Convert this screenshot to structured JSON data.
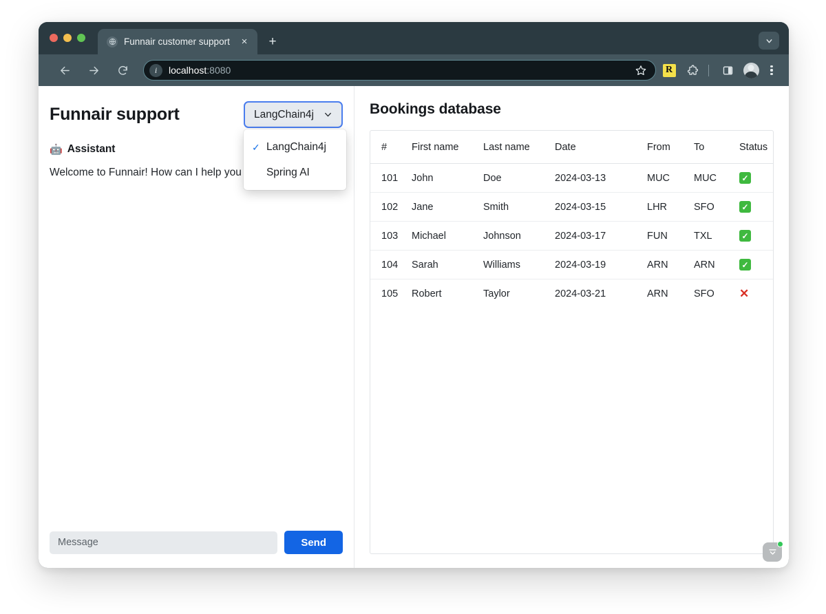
{
  "browser": {
    "tab": {
      "title": "Funnair customer support",
      "favicon_icon": "globe-icon",
      "close_icon": "×"
    },
    "new_tab_icon": "+",
    "tab_list_icon": "chevron-down-icon",
    "toolbar": {
      "back_icon": "arrow-left-icon",
      "forward_icon": "arrow-right-icon",
      "reload_icon": "reload-icon",
      "site_info_icon": "info-icon",
      "url_host": "localhost",
      "url_port": ":8080",
      "bookmark_icon": "star-icon",
      "extension_r_label": "R",
      "extensions_icon": "puzzle-piece-icon",
      "side_panel_icon": "side-panel-icon",
      "profile_icon": "avatar",
      "menu_icon": "three-dots-icon"
    }
  },
  "chat": {
    "title": "Funnair support",
    "model_select": {
      "selected": "LangChain4j",
      "chevron_icon": "chevron-down-icon",
      "open": true,
      "options": [
        {
          "label": "LangChain4j",
          "selected": true,
          "check_icon": "✓"
        },
        {
          "label": "Spring AI",
          "selected": false,
          "check_icon": "✓"
        }
      ]
    },
    "message": {
      "avatar_emoji": "🤖",
      "author": "Assistant",
      "text": "Welcome to Funnair! How can I help you today?"
    },
    "composer": {
      "placeholder": "Message",
      "value": "",
      "send_label": "Send"
    }
  },
  "bookings": {
    "title": "Bookings database",
    "columns": [
      "#",
      "First name",
      "Last name",
      "Date",
      "From",
      "To",
      "Status"
    ],
    "rows": [
      {
        "id": "101",
        "first": "John",
        "last": "Doe",
        "date": "2024-03-13",
        "from": "MUC",
        "to": "MUC",
        "status": "confirmed"
      },
      {
        "id": "102",
        "first": "Jane",
        "last": "Smith",
        "date": "2024-03-15",
        "from": "LHR",
        "to": "SFO",
        "status": "confirmed"
      },
      {
        "id": "103",
        "first": "Michael",
        "last": "Johnson",
        "date": "2024-03-17",
        "from": "FUN",
        "to": "TXL",
        "status": "confirmed"
      },
      {
        "id": "104",
        "first": "Sarah",
        "last": "Williams",
        "date": "2024-03-19",
        "from": "ARN",
        "to": "ARN",
        "status": "confirmed"
      },
      {
        "id": "105",
        "first": "Robert",
        "last": "Taylor",
        "date": "2024-03-21",
        "from": "ARN",
        "to": "SFO",
        "status": "cancelled"
      }
    ],
    "status_icons": {
      "confirmed": "✓",
      "cancelled": "✕"
    },
    "floating_widget_icon": "chevron-down-badge-icon"
  },
  "colors": {
    "accent_blue": "#1365e4",
    "browser_chrome": "#44565e",
    "status_ok_green": "#3fb93f",
    "status_fail_red": "#d93025",
    "badge_green": "#34c759"
  }
}
